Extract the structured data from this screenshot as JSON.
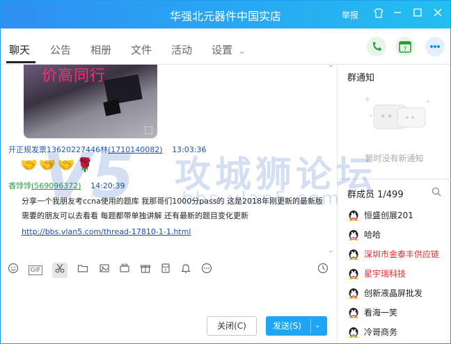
{
  "window": {
    "title": "华强北元器件中国实店",
    "report": "举报"
  },
  "tabs": [
    {
      "label": "聊天"
    },
    {
      "label": "公告"
    },
    {
      "label": "相册"
    },
    {
      "label": "文件"
    },
    {
      "label": "活动"
    },
    {
      "label": "设置"
    }
  ],
  "calendar_day": "7",
  "chat": {
    "photo_text": "价高同行",
    "messages": [
      {
        "sender": "开正规发票13620227446林",
        "sender_id": "(1710140082)",
        "time": "13:03:36"
      },
      {
        "sender": "香饽饽",
        "sender_id": "(569096372)",
        "time": "14:20:39",
        "text": "分享一个我朋友考ccna使用的题库 我那哥们1000分pass的 这是2018年刚更新的最新版 需要的朋友可以去看看 每题都带单独讲解 还有最新的题目变化更新",
        "link": "http://bbs.vlan5.com/thread-17810-1-1.html"
      }
    ],
    "emoji_row": "🤝🤝🤝🌹"
  },
  "buttons": {
    "close": "关闭(C)",
    "send": "发送(S)"
  },
  "side": {
    "notice_title": "群通知",
    "notice_empty": "暂时没有新通知",
    "members_title": "群成员 1/499",
    "members": [
      {
        "name": "恒盛创展201",
        "color": "#222222"
      },
      {
        "name": "哈哈",
        "color": "#222222"
      },
      {
        "name": "深圳市金泰丰供应链",
        "color": "#e22b2b"
      },
      {
        "name": "星宇瑞科技",
        "color": "#e22b2b"
      },
      {
        "name": "创新液晶屏批发",
        "color": "#222222"
      },
      {
        "name": "看海一笑",
        "color": "#222222"
      },
      {
        "name": "冷哥商务",
        "color": "#222222"
      }
    ]
  },
  "watermark": {
    "text": "攻城狮论坛",
    "url": "bbs.vlan5.com",
    "logo": "V5"
  },
  "colors": {
    "accent": "#1ea6f5",
    "title_bar": "#2f8ff3"
  }
}
